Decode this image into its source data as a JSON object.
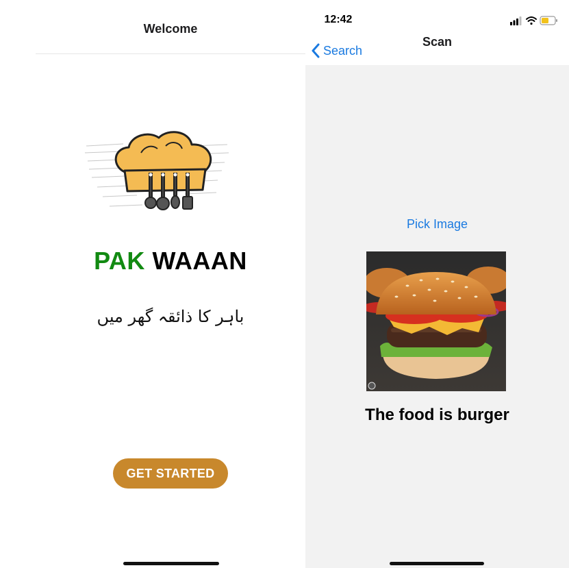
{
  "welcome_screen": {
    "nav_title": "Welcome",
    "logo_icon": "chef-hat-kitchen-utensils-icon",
    "brand_part1": "PAK",
    "brand_part2": "WAAAN",
    "tagline": "باہر کا ذائقہ گھر میں",
    "button_label": "GET STARTED",
    "colors": {
      "brand_green": "#128a12",
      "button": "#c8882c"
    }
  },
  "scan_screen": {
    "status_time": "12:42",
    "status_icons": [
      "cellular-signal-icon",
      "wifi-icon",
      "battery-icon"
    ],
    "back_label": "Search",
    "nav_title": "Scan",
    "pick_image_label": "Pick Image",
    "image_subject": "burger-photo",
    "result_text": "The food is burger",
    "colors": {
      "link": "#1a7ae0",
      "background": "#f2f2f2"
    }
  }
}
